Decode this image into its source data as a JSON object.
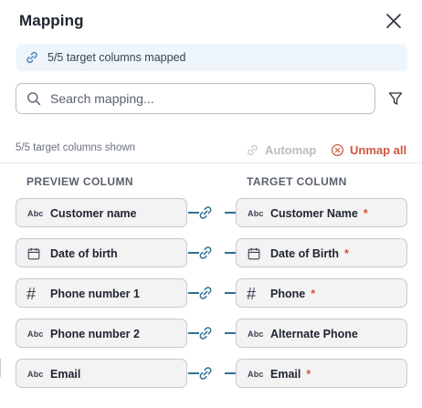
{
  "panel": {
    "title": "Mapping",
    "close_icon": "close-icon"
  },
  "status": {
    "icon": "link-icon",
    "text": "5/5 target columns mapped"
  },
  "search": {
    "placeholder": "Search mapping...",
    "value": "",
    "icon": "search-icon",
    "filter_icon": "filter-icon"
  },
  "toolbar": {
    "count_text": "5/5 target columns shown",
    "automap_label": "Automap",
    "unmap_label": "Unmap all"
  },
  "columns": {
    "preview_header": "PREVIEW COLUMN",
    "target_header": "TARGET COLUMN"
  },
  "rows": [
    {
      "preview": {
        "type": "text",
        "type_label": "Abc",
        "label": "Customer name"
      },
      "target": {
        "type": "text",
        "type_label": "Abc",
        "label": "Customer Name",
        "required": "*"
      }
    },
    {
      "preview": {
        "type": "date",
        "type_label": "",
        "label": "Date of birth"
      },
      "target": {
        "type": "date",
        "type_label": "",
        "label": "Date of Birth",
        "required": "*"
      }
    },
    {
      "preview": {
        "type": "number",
        "type_label": "#",
        "label": "Phone number 1"
      },
      "target": {
        "type": "number",
        "type_label": "#",
        "label": "Phone",
        "required": "*"
      }
    },
    {
      "preview": {
        "type": "text",
        "type_label": "Abc",
        "label": "Phone number 2"
      },
      "target": {
        "type": "text",
        "type_label": "Abc",
        "label": "Alternate Phone",
        "required": ""
      }
    },
    {
      "preview": {
        "type": "text",
        "type_label": "Abc",
        "label": "Email"
      },
      "target": {
        "type": "text",
        "type_label": "Abc",
        "label": "Email",
        "required": "*"
      }
    }
  ],
  "colors": {
    "accent_link": "#2f6f95",
    "danger": "#d0563f",
    "banner_bg": "#eef5fb",
    "disabled": "#b8bcc4"
  }
}
